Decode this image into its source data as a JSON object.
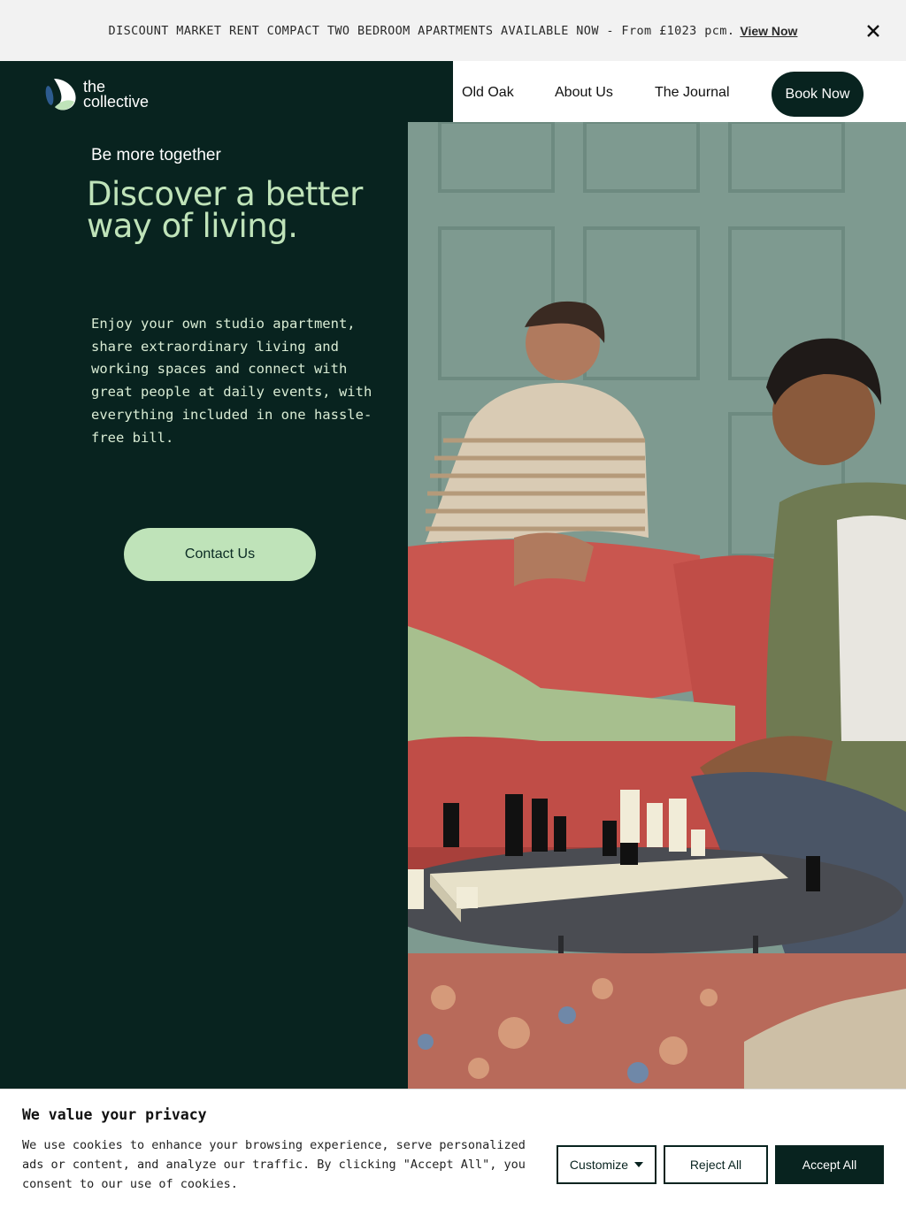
{
  "announcement": {
    "text": "DISCOUNT MARKET RENT COMPACT TWO BEDROOM APARTMENTS AVAILABLE NOW - From £1023 pcm.",
    "link_label": "View Now",
    "close_icon": "close-icon"
  },
  "header": {
    "logo_line1": "the",
    "logo_line2": "collective",
    "nav": [
      {
        "label": "Old Oak"
      },
      {
        "label": "About Us"
      },
      {
        "label": "The Journal"
      }
    ],
    "cta_label": "Book Now"
  },
  "hero": {
    "tagline": "Be more together",
    "headline": "Discover a better way of living.",
    "body": "Enjoy your own studio apartment, share extraordinary living and working spaces and connect with great people at daily events, with everything included in one hassle-free bill.",
    "cta_label": "Contact Us"
  },
  "cookie_banner": {
    "title": "We value your privacy",
    "text": "We use cookies to enhance your browsing experience, serve personalized ads or content, and analyze our traffic. By clicking \"Accept All\", you consent to our use of cookies.",
    "customize_label": "Customize",
    "reject_label": "Reject All",
    "accept_label": "Accept All"
  },
  "colors": {
    "brand_dark": "#08231f",
    "brand_green": "#bfe3b9",
    "announcement_bg": "#f2f2f2"
  }
}
